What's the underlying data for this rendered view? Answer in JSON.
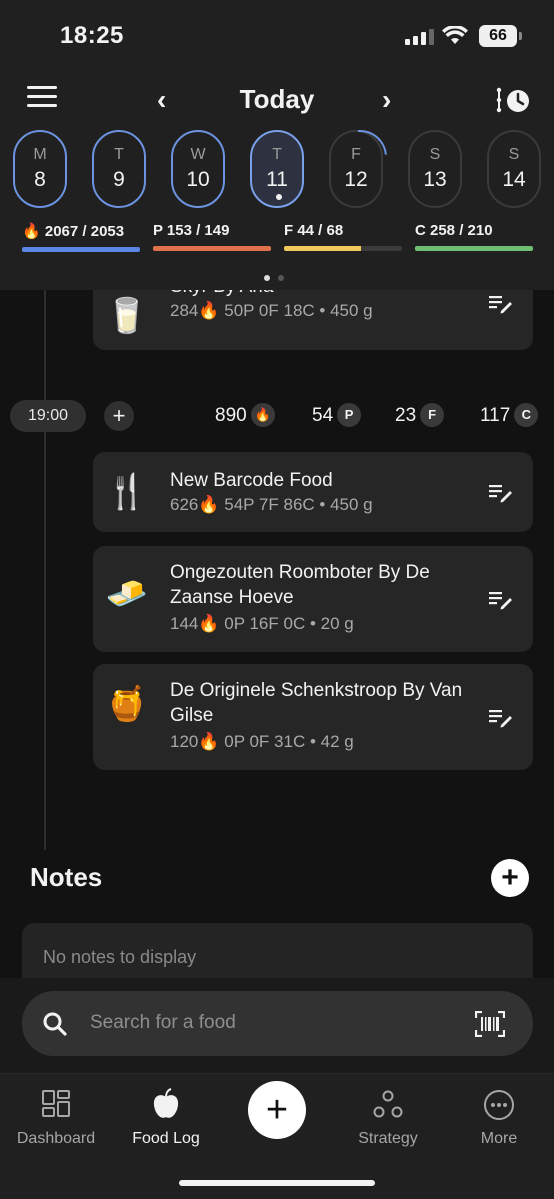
{
  "status": {
    "time": "18:25",
    "battery": "66"
  },
  "header": {
    "title": "Today",
    "prev_icon": "chevron-left-icon",
    "next_icon": "chevron-right-icon"
  },
  "days": [
    {
      "letter": "M",
      "num": "8",
      "state": "blue"
    },
    {
      "letter": "T",
      "num": "9",
      "state": "blue"
    },
    {
      "letter": "W",
      "num": "10",
      "state": "blue"
    },
    {
      "letter": "T",
      "num": "11",
      "state": "selected"
    },
    {
      "letter": "F",
      "num": "12",
      "state": "partial"
    },
    {
      "letter": "S",
      "num": "13",
      "state": "empty"
    },
    {
      "letter": "S",
      "num": "14",
      "state": "empty"
    }
  ],
  "macros": [
    {
      "label": "2067 / 2053",
      "prefix": "",
      "color": "#5b86e5",
      "fraction": 1.0
    },
    {
      "label": "P 153 / 149",
      "prefix": "P",
      "color": "#e0714c",
      "fraction": 1.0
    },
    {
      "label": "F 44 / 68",
      "prefix": "F",
      "color": "#f0c75a",
      "fraction": 0.65
    },
    {
      "label": "C 258 / 210",
      "prefix": "C",
      "color": "#6fbf73",
      "fraction": 1.0
    }
  ],
  "entries_top": {
    "name": "Skyr By Arla",
    "macros": "284 🔥 50P   0F   18C  •  450 g",
    "kcal": "284",
    "rest": "50P   0F   18C  •  450 g"
  },
  "meal": {
    "time": "19:00",
    "kcal": "890",
    "protein": "54",
    "fat": "23",
    "carbs": "117",
    "p_label": "P",
    "f_label": "F",
    "c_label": "C"
  },
  "foods": [
    {
      "name": "New Barcode Food",
      "kcal": "626",
      "rest": "54P   7F   86C  •  450 g",
      "icon": "🍴"
    },
    {
      "name": "Ongezouten Roomboter By De Zaanse Hoeve",
      "kcal": "144",
      "rest": "0P   16F   0C  •  20 g",
      "icon": "🧈"
    },
    {
      "name": "De Originele Schenkstroop By Van Gilse",
      "kcal": "120",
      "rest": "0P   0F   31C  •  42 g",
      "icon": "🍯"
    }
  ],
  "notes": {
    "title": "Notes",
    "empty": "No notes to display"
  },
  "search": {
    "placeholder": "Search for a food"
  },
  "tabs": [
    {
      "label": "Dashboard"
    },
    {
      "label": "Food Log"
    },
    {
      "label": "Strategy"
    },
    {
      "label": "More"
    }
  ]
}
